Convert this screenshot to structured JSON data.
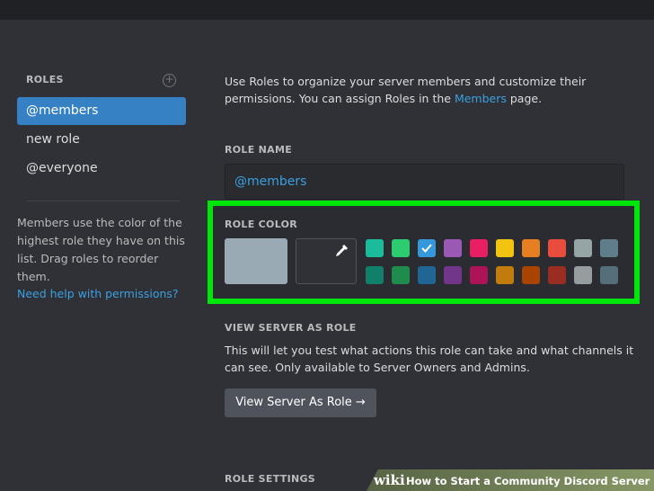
{
  "sidebar": {
    "header": "ROLES",
    "add_icon": "plus-circle-icon",
    "roles": [
      {
        "label": "@members",
        "active": true
      },
      {
        "label": "new role",
        "active": false
      },
      {
        "label": "@everyone",
        "active": false
      }
    ],
    "help_text": "Members use the color of the highest role they have on this list. Drag roles to reorder them.",
    "help_link": "Need help with permissions?"
  },
  "main": {
    "intro_part1": "Use Roles to organize your server members and customize their permissions. You can assign Roles in the",
    "intro_link": "Members",
    "intro_part2": "page.",
    "role_name_label": "ROLE NAME",
    "role_name_value": "@members",
    "role_color_label": "ROLE COLOR",
    "default_color": "#99aab5",
    "custom_color_icon": "eyedropper-icon",
    "swatches_top": [
      "#1abc9c",
      "#2ecc71",
      "#3498db",
      "#9b59b6",
      "#e91e63",
      "#f1c40f",
      "#e67e22",
      "#e74c3c",
      "#95a5a6",
      "#607d8b"
    ],
    "swatches_bottom": [
      "#11806a",
      "#1f8b4c",
      "#206694",
      "#71368a",
      "#ad1457",
      "#c27c0e",
      "#a84300",
      "#992d22",
      "#979c9f",
      "#546e7a"
    ],
    "selected_swatch": "#3498db",
    "view_as_label": "VIEW SERVER AS ROLE",
    "view_as_desc": "This will let you test what actions this role can take and what channels it can see. Only available to Server Owners and Admins.",
    "view_as_button": "View Server As Role →",
    "role_settings_label": "ROLE SETTINGS"
  },
  "watermark": {
    "brand": "wiki",
    "text": "How to Start a Community Discord Server"
  },
  "colors": {
    "background": "#2f3136",
    "accent": "#3680c4",
    "link": "#3aa0e0",
    "highlight": "#00e60a"
  }
}
